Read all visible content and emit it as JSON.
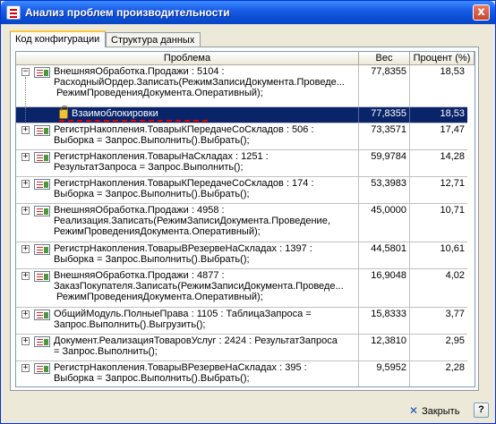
{
  "window": {
    "title": "Анализ проблем производительности",
    "close_glyph": "x"
  },
  "tabs": [
    {
      "label": "Код конфигурации",
      "active": true
    },
    {
      "label": "Структура данных",
      "active": false
    }
  ],
  "columns": {
    "problem": "Проблема",
    "weight": "Вес",
    "percent": "Процент (%)"
  },
  "rows": [
    {
      "expander": "−",
      "text": "ВнешняяОбработка.Продажи : 5104 :\nРасходныйОрдер.Записать(РежимЗаписиДокумента.Проведе...\n РежимПроведенияДокумента.Оперативный);",
      "weight": "77,8355",
      "percent": "18,53"
    },
    {
      "selected": true,
      "text": "Взаимоблокировки",
      "weight": "77,8355",
      "percent": "18,53"
    },
    {
      "expander": "+",
      "text": "РегистрНакопления.ТоварыКПередачеСоСкладов : 506 :\nВыборка = Запрос.Выполнить().Выбрать();",
      "weight": "73,3571",
      "percent": "17,47"
    },
    {
      "expander": "+",
      "text": "РегистрНакопления.ТоварыНаСкладах : 1251 :\nРезультатЗапроса = Запрос.Выполнить();",
      "weight": "59,9784",
      "percent": "14,28"
    },
    {
      "expander": "+",
      "text": "РегистрНакопления.ТоварыКПередачеСоСкладов : 174 :\nВыборка = Запрос.Выполнить().Выбрать();",
      "weight": "53,3983",
      "percent": "12,71"
    },
    {
      "expander": "+",
      "text": "ВнешняяОбработка.Продажи : 4958 :\nРеализация.Записать(РежимЗаписиДокумента.Проведение,\nРежимПроведенияДокумента.Оперативный);",
      "weight": "45,0000",
      "percent": "10,71"
    },
    {
      "expander": "+",
      "text": "РегистрНакопления.ТоварыВРезервеНаСкладах : 1397 :\nВыборка = Запрос.Выполнить().Выбрать();",
      "weight": "44,5801",
      "percent": "10,61"
    },
    {
      "expander": "+",
      "text": "ВнешняяОбработка.Продажи : 4877 :\nЗаказПокупателя.Записать(РежимЗаписиДокумента.Проведе...\n РежимПроведенияДокумента.Оперативный);",
      "weight": "16,9048",
      "percent": "4,02"
    },
    {
      "expander": "+",
      "text": "ОбщийМодуль.ПолныеПрава : 1105 : ТаблицаЗапроса =\nЗапрос.Выполнить().Выгрузить();",
      "weight": "15,8333",
      "percent": "3,77"
    },
    {
      "expander": "+",
      "text": "Документ.РеализацияТоваровУслуг : 2424 : РезультатЗапроса\n= Запрос.Выполнить();",
      "weight": "12,3810",
      "percent": "2,95"
    },
    {
      "expander": "+",
      "text": "РегистрНакопления.ТоварыВРезервеНаСкладах : 395 :\nВыборка = Запрос.Выполнить().Выбрать();",
      "weight": "9,5952",
      "percent": "2,28"
    }
  ],
  "footer": {
    "close_label": "Закрыть",
    "close_glyph": "✕",
    "help_label": "?"
  }
}
